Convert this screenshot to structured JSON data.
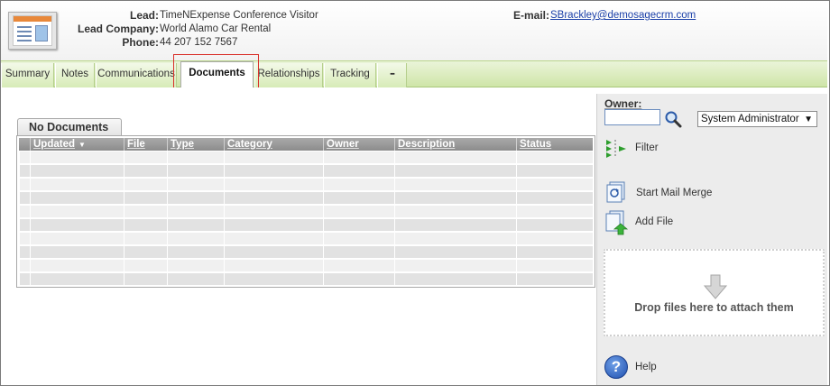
{
  "header": {
    "lead_label": "Lead:",
    "lead_value": "TimeNExpense Conference Visitor",
    "company_label": "Lead Company:",
    "company_value": "World Alamo Car Rental",
    "phone_label": "Phone:",
    "phone_value": "44 207 152 7567",
    "email_label": "E-mail:",
    "email_value": "SBrackley@demosagecrm.com"
  },
  "tabs": [
    {
      "label": "Summary"
    },
    {
      "label": "Notes"
    },
    {
      "label": "Communications"
    },
    {
      "label": "Documents",
      "active": true
    },
    {
      "label": "Relationships"
    },
    {
      "label": "Tracking"
    },
    {
      "label": "▪▪▪"
    }
  ],
  "grid": {
    "tab_title": "No Documents",
    "columns": [
      "Updated",
      "File",
      "Type",
      "Category",
      "Owner",
      "Description",
      "Status"
    ],
    "sort_column": "Updated",
    "rows": []
  },
  "side": {
    "owner_label": "Owner:",
    "owner_input_value": "",
    "owner_select_value": "System Administrator",
    "filter_label": "Filter",
    "mail_merge_label": "Start Mail Merge",
    "add_file_label": "Add File",
    "dropzone_text": "Drop files here to attach them",
    "help_label": "Help"
  },
  "colors": {
    "tab_bar": "#cfe5a8",
    "grid_header": "#8c8c8c",
    "link": "#1a3fa8",
    "highlight": "#d9302a"
  }
}
